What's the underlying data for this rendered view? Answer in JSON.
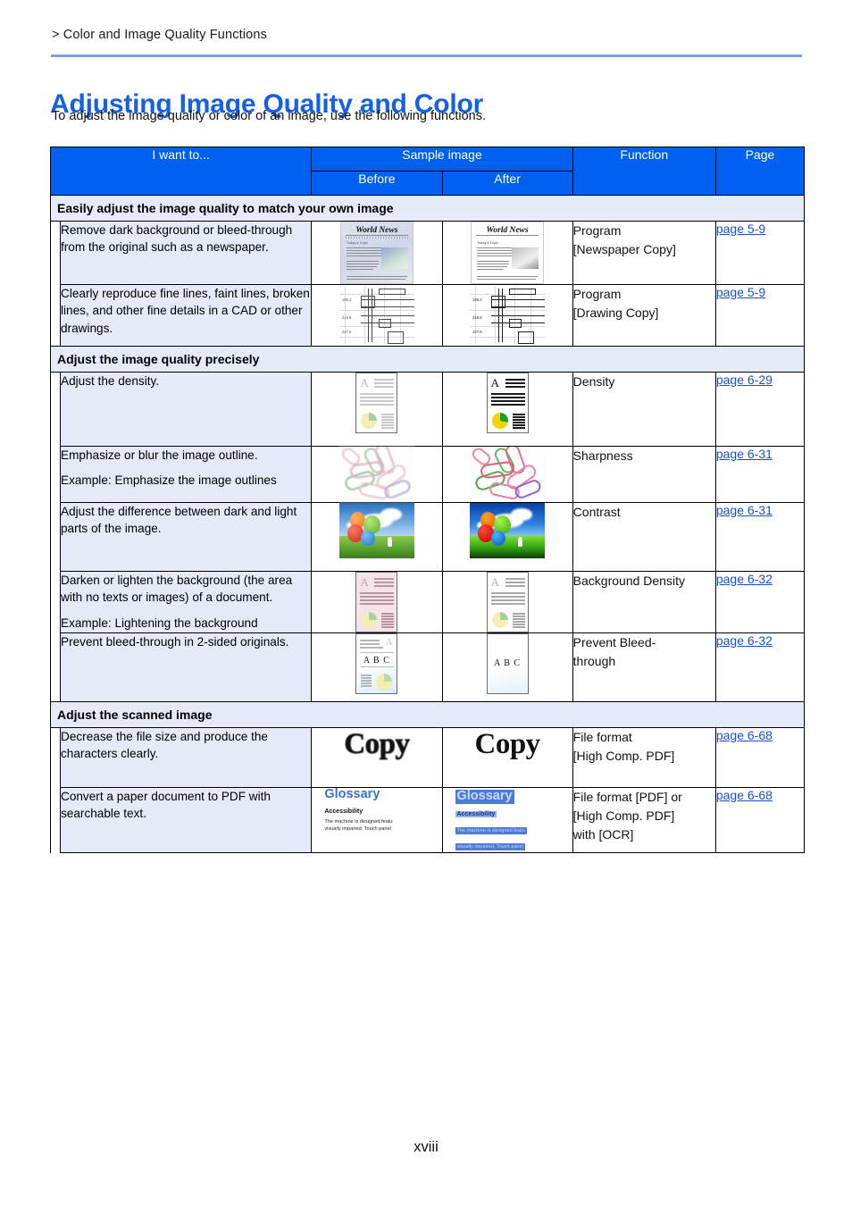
{
  "breadcrumb": "> Color and Image Quality Functions",
  "title": "Adjusting Image Quality and Color",
  "intro": "To adjust the image quality or color of an image, use the following functions.",
  "folio": "xviii",
  "colors": {
    "header_blue": "#0060f0",
    "title_blue": "#1560e6",
    "band_lavender": "#e4eaf8",
    "link_blue": "#1a4fd6",
    "rule_blue": "#7b9fe0"
  },
  "table": {
    "headers": {
      "want": "I want to...",
      "sample": "Sample image",
      "before": "Before",
      "after": "After",
      "function": "Function",
      "page": "Page"
    },
    "sections": [
      {
        "band": "Easily adjust the image quality to match your own image",
        "rows": [
          {
            "want": [
              "Remove dark background or bleed-through from the original such as a newspaper."
            ],
            "sample": "newspaper",
            "function": [
              "Program",
              "[Newspaper Copy]"
            ],
            "page": "page 5-9"
          },
          {
            "want": [
              "Clearly reproduce fine lines, faint lines, broken lines, and other fine details in a CAD or other drawings."
            ],
            "sample": "cad",
            "function": [
              "Program",
              "[Drawing Copy]"
            ],
            "page": "page 5-9"
          }
        ]
      },
      {
        "band": "Adjust the image quality precisely",
        "rows": [
          {
            "want": [
              "Adjust the density."
            ],
            "sample": "density",
            "function": [
              "Density"
            ],
            "page": "page 6-29"
          },
          {
            "want": [
              "Emphasize or blur the image outline.",
              "Example: Emphasize the image outlines"
            ],
            "sample": "clips",
            "function": [
              "Sharpness"
            ],
            "page": "page 6-31"
          },
          {
            "want": [
              "Adjust the difference between dark and light parts of the image."
            ],
            "sample": "balloons",
            "function": [
              "Contrast"
            ],
            "page": "page 6-31"
          },
          {
            "want": [
              "Darken or lighten the background (the area with no texts or images) of a document.",
              "Example: Lightening the background"
            ],
            "sample": "bgdensity",
            "function": [
              "Background Density"
            ],
            "page": "page 6-32"
          },
          {
            "want": [
              "Prevent bleed-through in 2-sided originals."
            ],
            "sample": "bleed",
            "function": [
              "Prevent Bleed-",
              "through"
            ],
            "page": "page 6-32"
          }
        ]
      },
      {
        "band": "Adjust the scanned image",
        "rows": [
          {
            "want": [
              "Decrease the file size and produce the characters clearly."
            ],
            "sample": "copy",
            "function": [
              "File format",
              "[High Comp. PDF]"
            ],
            "page": "page 6-68"
          },
          {
            "want": [
              "Convert a paper document to PDF with searchable text."
            ],
            "sample": "glossary",
            "function": [
              "File format [PDF] or",
              "[High Comp. PDF]",
              "with [OCR]"
            ],
            "page": "page 6-68"
          }
        ]
      }
    ]
  },
  "samples": {
    "newspaper": {
      "title": "World News",
      "subhead": "Today's Topic"
    },
    "cad": {
      "dims": [
        "195.3",
        "216.8",
        "227.6"
      ]
    },
    "bleed": {
      "text": "A B C",
      "letter": "A"
    },
    "density": {
      "letter": "A"
    },
    "bgdensity": {
      "letter": "A"
    },
    "copy": {
      "text": "Copy"
    },
    "glossary": {
      "heading": "Glossary",
      "subheading": "Accessibility",
      "body_line1": "The machine is designed featu",
      "body_line2": "visually impaired. Touch panel"
    }
  }
}
